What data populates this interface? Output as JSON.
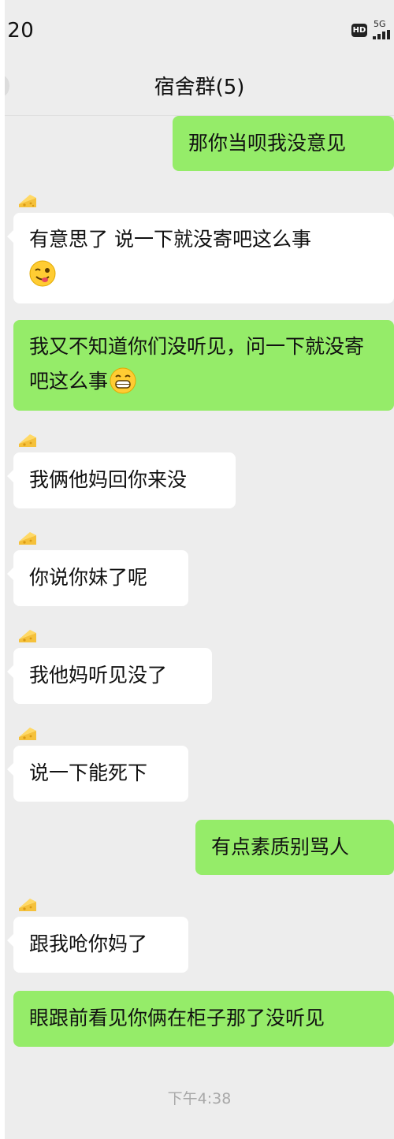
{
  "status_bar": {
    "time": ":20",
    "hd_badge": "HD",
    "network": "5G"
  },
  "header": {
    "title": "宿舍群(5)"
  },
  "colors": {
    "chat_background": "#ededed",
    "outgoing_bubble": "#95ec69",
    "incoming_bubble": "#ffffff"
  },
  "messages": [
    {
      "sender": "me",
      "text": "那你当呗我没意见"
    },
    {
      "sender": "other",
      "avatar_icon": "cheese-icon",
      "text": "有意思了 说一下就没寄吧这么事",
      "emoji": "winking-tongue-emoji"
    },
    {
      "sender": "me",
      "text": "我又不知道你们没听见，问一下就没寄吧这么事",
      "emoji": "grinning-emoji"
    },
    {
      "sender": "other",
      "avatar_icon": "cheese-icon",
      "text": "我俩他妈回你来没"
    },
    {
      "sender": "other",
      "avatar_icon": "cheese-icon",
      "text": "你说你妹了呢"
    },
    {
      "sender": "other",
      "avatar_icon": "cheese-icon",
      "text": "我他妈听见没了"
    },
    {
      "sender": "other",
      "avatar_icon": "cheese-icon",
      "text": "说一下能死下"
    },
    {
      "sender": "me",
      "text": "有点素质别骂人"
    },
    {
      "sender": "other",
      "avatar_icon": "cheese-icon",
      "text": "跟我呛你妈了"
    },
    {
      "sender": "me",
      "text": "眼跟前看见你俩在柜子那了没听见"
    }
  ],
  "timestamp": "下午4:38"
}
